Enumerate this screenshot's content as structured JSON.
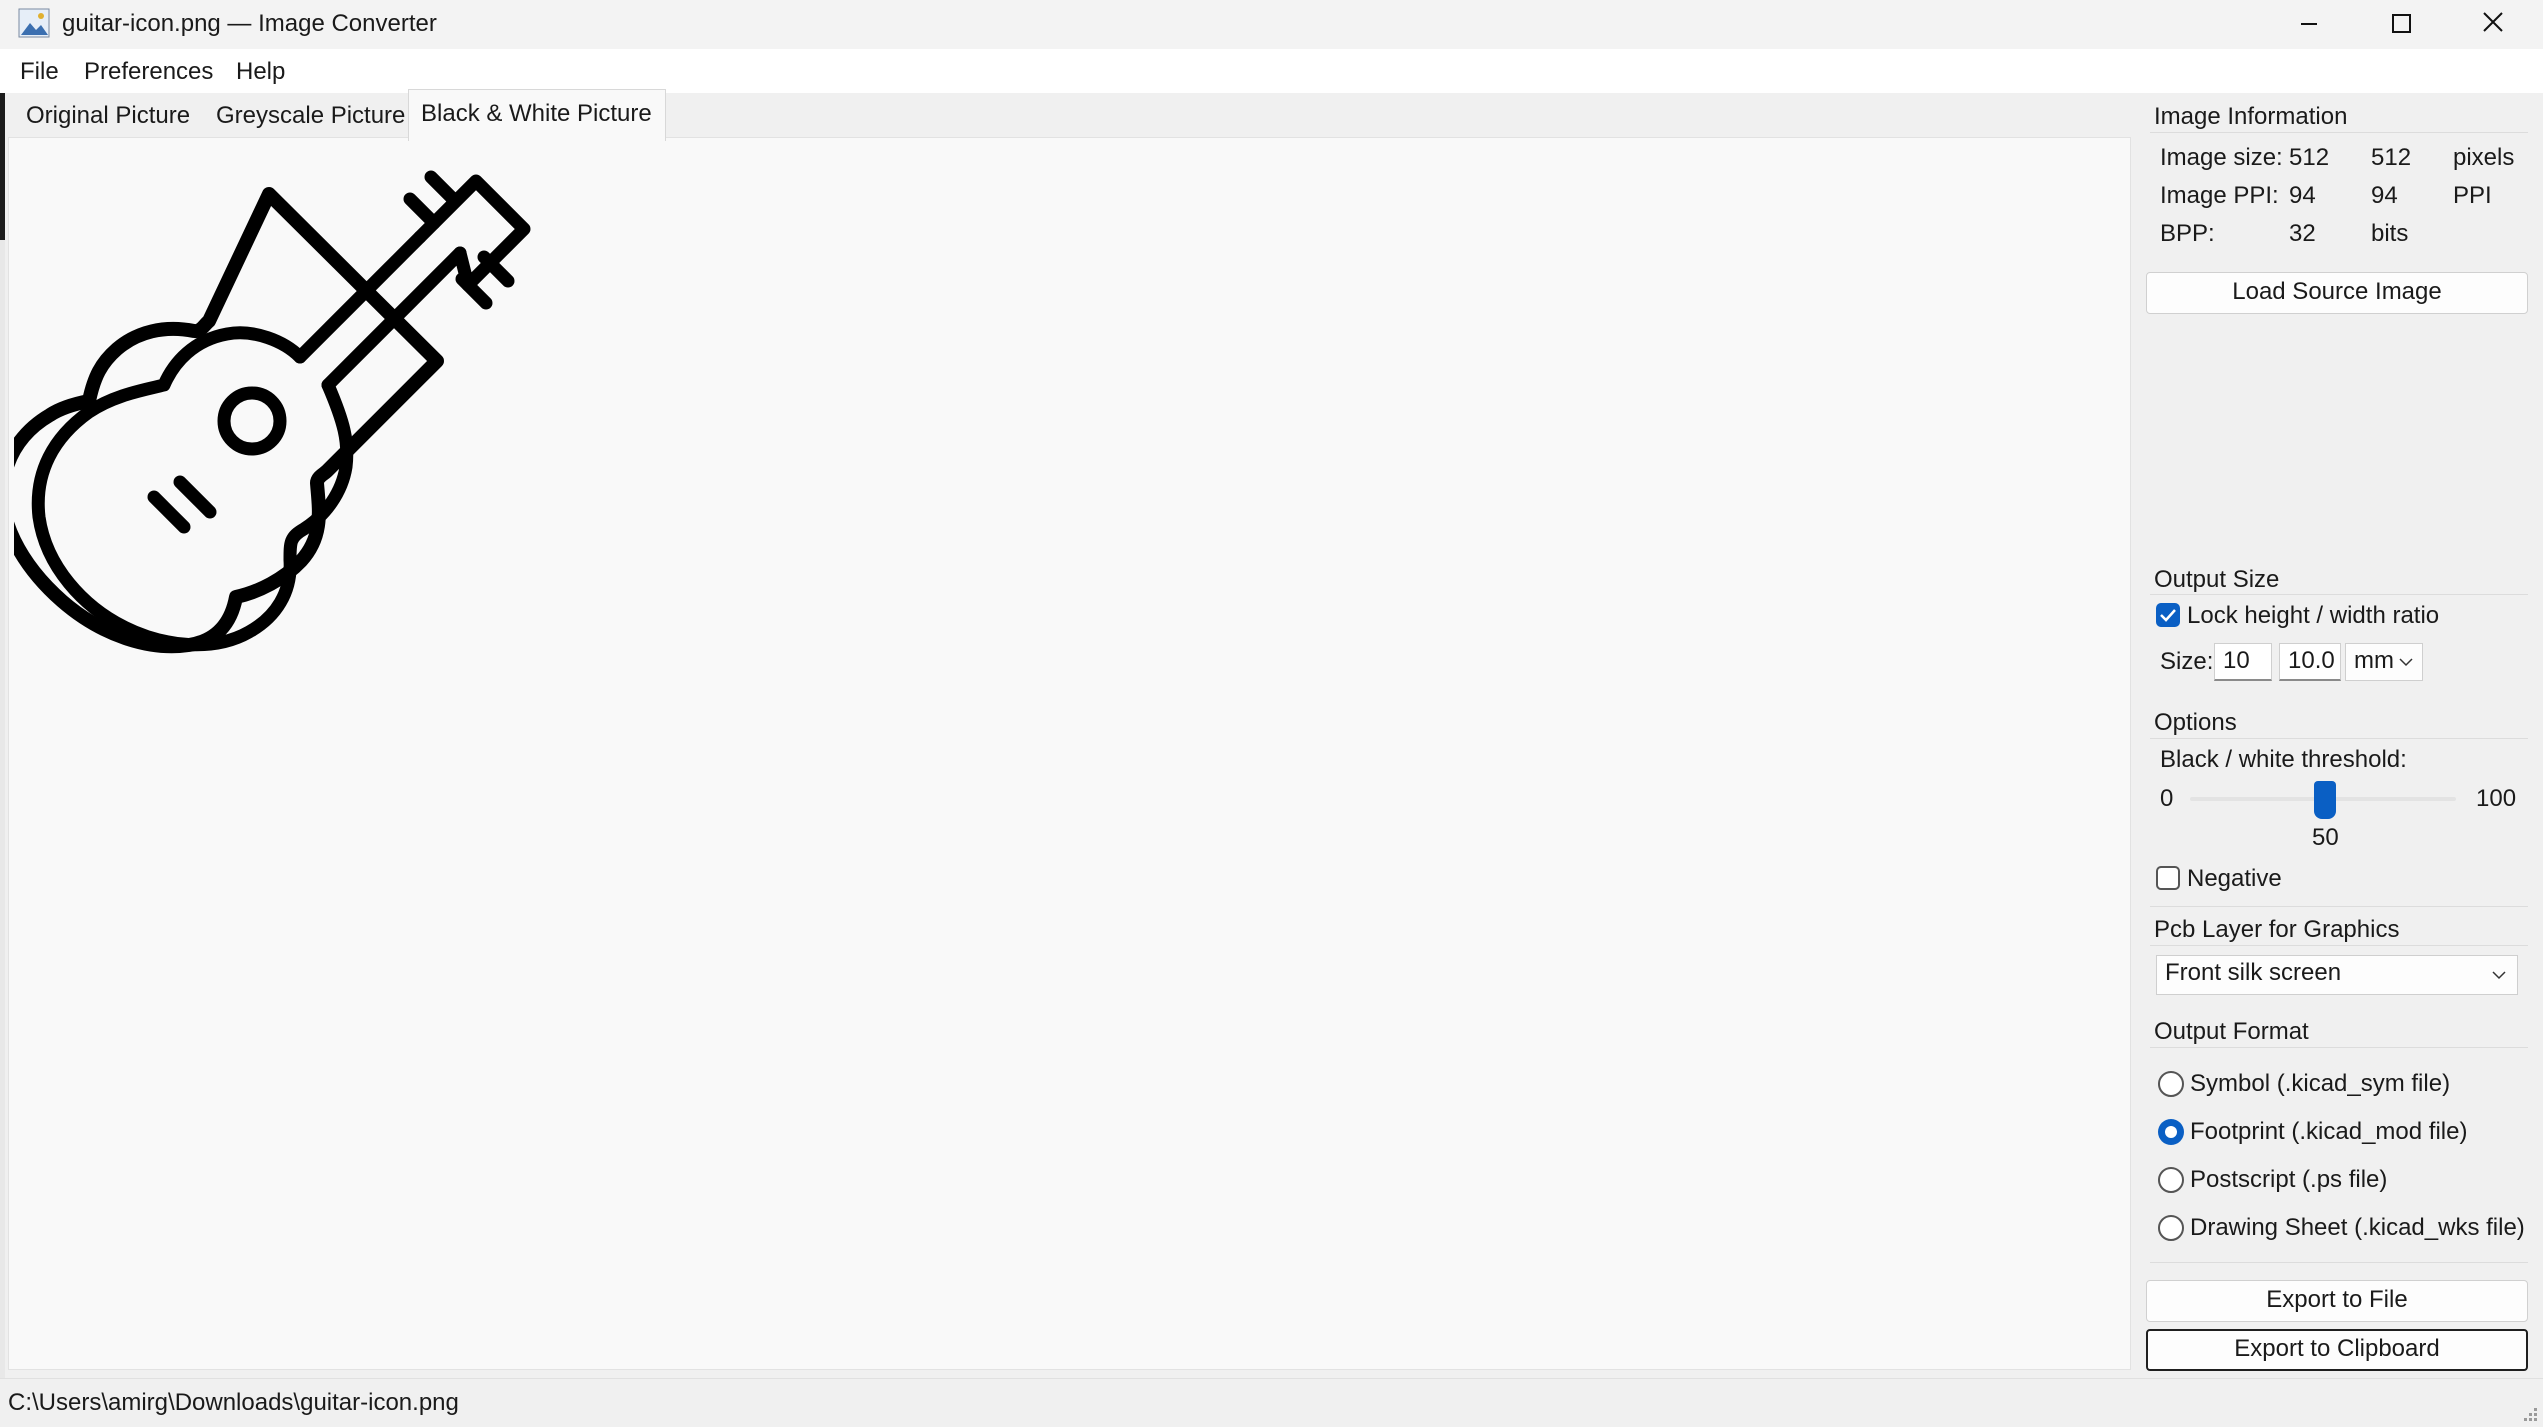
{
  "window": {
    "title": "guitar-icon.png — Image Converter",
    "icon": "image-converter-icon",
    "controls": [
      "minimize-icon",
      "maximize-icon",
      "close-icon"
    ]
  },
  "menu": {
    "file": "File",
    "preferences": "Preferences",
    "help": "Help"
  },
  "tabs": {
    "original": "Original Picture",
    "greyscale": "Greyscale Picture",
    "bw": "Black & White Picture",
    "selected": "Black & White Picture"
  },
  "preview": {
    "icon": "guitar-icon"
  },
  "image_info": {
    "title": "Image Information",
    "size_label": "Image size:",
    "size_w": "512",
    "size_h": "512",
    "size_unit": "pixels",
    "ppi_label": "Image PPI:",
    "ppi_x": "94",
    "ppi_y": "94",
    "ppi_unit": "PPI",
    "bpp_label": "BPP:",
    "bpp_value": "32",
    "bpp_unit": "bits"
  },
  "load_button": "Load Source Image",
  "output_size": {
    "title": "Output Size",
    "lock_label": "Lock height / width ratio",
    "lock_checked": true,
    "size_label": "Size:",
    "size_value_1": "10",
    "size_value_2": "10.0",
    "unit": "mm"
  },
  "options": {
    "title": "Options",
    "threshold_label": "Black / white threshold:",
    "min": "0",
    "max": "100",
    "value": "50",
    "negative_label": "Negative",
    "negative_checked": false
  },
  "pcb_layer": {
    "title": "Pcb Layer for Graphics",
    "selected": "Front silk screen"
  },
  "output_format": {
    "title": "Output Format",
    "options": [
      {
        "label": "Symbol (.kicad_sym file)",
        "selected": false
      },
      {
        "label": "Footprint (.kicad_mod file)",
        "selected": true
      },
      {
        "label": "Postscript (.ps file)",
        "selected": false
      },
      {
        "label": "Drawing Sheet (.kicad_wks file)",
        "selected": false
      }
    ]
  },
  "export_file": "Export to File",
  "export_clipboard": "Export to Clipboard",
  "status": {
    "path": "C:\\Users\\amirg\\Downloads\\guitar-icon.png"
  },
  "colors": {
    "accent": "#0a5fc4",
    "background": "#f0f0f0",
    "canvas": "#f9f9f9"
  }
}
